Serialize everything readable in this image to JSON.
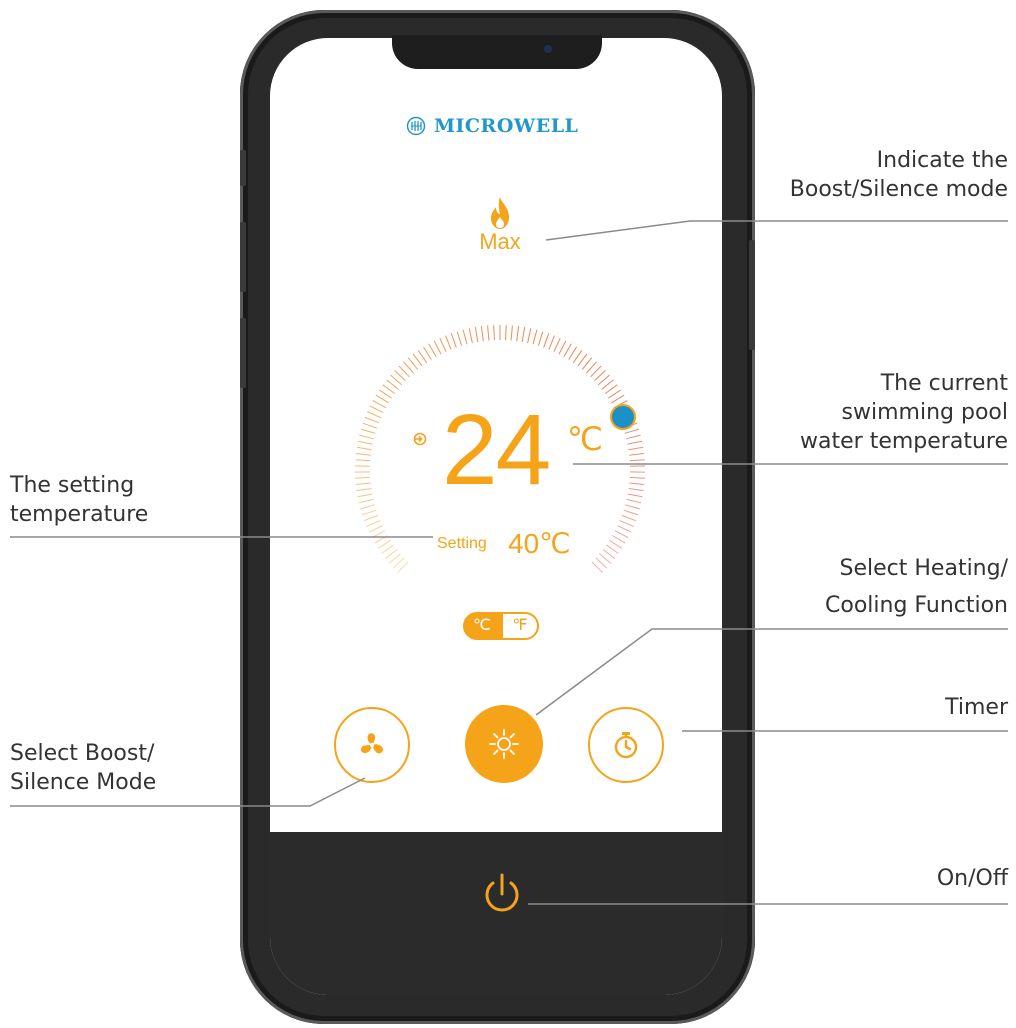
{
  "brand": {
    "name": "MICROWELL",
    "logo_icon": "microwell-logo-icon"
  },
  "mode": {
    "label": "Max",
    "icon": "flame-icon"
  },
  "temperature": {
    "current_value": "24",
    "current_unit": "℃",
    "setting_label": "Setting",
    "setting_value": "40℃"
  },
  "unit_toggle": {
    "celsius": "℃",
    "fahrenheit": "℉",
    "selected": "celsius"
  },
  "controls": {
    "fan": {
      "icon": "fan-icon"
    },
    "heating": {
      "icon": "sun-icon"
    },
    "timer": {
      "icon": "stopwatch-icon"
    },
    "power": {
      "icon": "power-icon"
    }
  },
  "annotations": {
    "boost_indicator": [
      "Indicate the",
      "Boost/Silence mode"
    ],
    "current_temp": [
      "The current",
      "swimming pool",
      "water temperature"
    ],
    "setting_temp": [
      "The setting",
      "temperature"
    ],
    "heating_cooling": [
      "Select Heating/",
      "Cooling Function"
    ],
    "timer": [
      "Timer"
    ],
    "boost_select": [
      "Select Boost/",
      "Silence Mode"
    ],
    "on_off": [
      "On/Off"
    ]
  },
  "colors": {
    "accent": "#f5a318",
    "brand_blue": "#2196cf",
    "indicator_blue": "#1e90c8",
    "bottom_bar": "#2b2b2b"
  }
}
